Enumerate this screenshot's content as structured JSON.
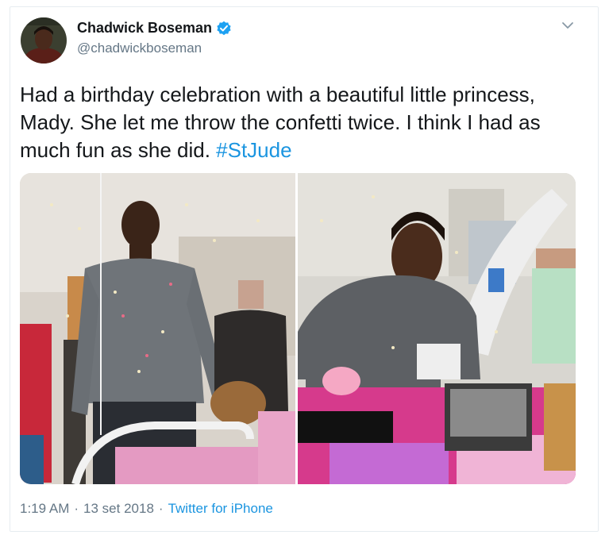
{
  "tweet": {
    "display_name": "Chadwick Boseman",
    "handle": "@chadwickboseman",
    "verified": true,
    "text_main": "Had a birthday celebration with a beautiful little princess, Mady. She let me throw the confetti twice. I think I had as much fun as she did. ",
    "hashtag": "#StJude",
    "time": "1:19 AM",
    "date": "13 set 2018",
    "separator": "·",
    "source": "Twitter for iPhone",
    "icons": {
      "verified": "verified-badge-icon",
      "menu": "chevron-down-icon"
    },
    "colors": {
      "link": "#1b95e0",
      "secondary_text": "#657786",
      "verified_badge": "#1da1f2"
    }
  }
}
